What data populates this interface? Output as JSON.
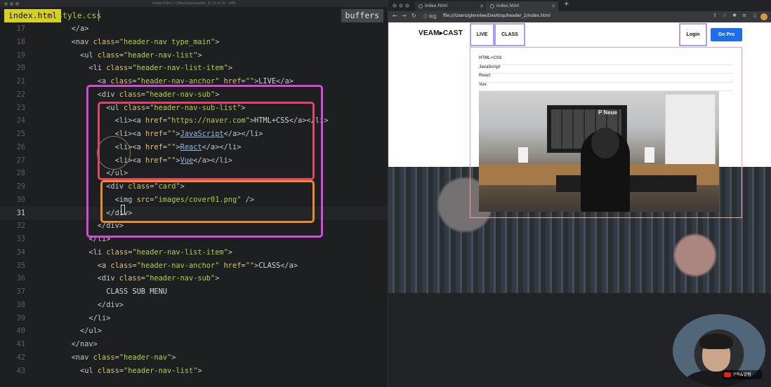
{
  "editor": {
    "window_title": "index.html (~/Desktop/header_2) (1 of 3) - VIM",
    "tabs": [
      {
        "label": "index.html",
        "active": true
      },
      {
        "label": "style.css",
        "active": false
      }
    ],
    "buffers_label": "buffers",
    "current_line": 31,
    "lines": [
      {
        "n": "17",
        "tokens": [
          [
            "i",
            "        "
          ],
          [
            "tag",
            "</a>"
          ]
        ]
      },
      {
        "n": "18",
        "tokens": [
          [
            "i",
            "        "
          ],
          [
            "tag",
            "<nav "
          ],
          [
            "attr",
            "class"
          ],
          [
            "tag",
            "="
          ],
          [
            "val",
            "\"header-nav type_main\""
          ],
          [
            "tag",
            ">"
          ]
        ]
      },
      {
        "n": "19",
        "tokens": [
          [
            "i",
            "          "
          ],
          [
            "tag",
            "<ul "
          ],
          [
            "attr",
            "class"
          ],
          [
            "tag",
            "="
          ],
          [
            "val",
            "\"header-nav-list\""
          ],
          [
            "tag",
            ">"
          ]
        ]
      },
      {
        "n": "20",
        "tokens": [
          [
            "i",
            "            "
          ],
          [
            "tag",
            "<li "
          ],
          [
            "attr",
            "class"
          ],
          [
            "tag",
            "="
          ],
          [
            "val",
            "\"header-nav-list-item\""
          ],
          [
            "tag",
            ">"
          ]
        ]
      },
      {
        "n": "21",
        "tokens": [
          [
            "i",
            "              "
          ],
          [
            "tag",
            "<a "
          ],
          [
            "attr",
            "class"
          ],
          [
            "tag",
            "="
          ],
          [
            "val",
            "\"header-nav-anchor\""
          ],
          [
            "tag",
            " "
          ],
          [
            "attr",
            "href"
          ],
          [
            "tag",
            "="
          ],
          [
            "val",
            "\"\""
          ],
          [
            "tag",
            ">"
          ],
          [
            "txt",
            "LIVE"
          ],
          [
            "tag",
            "</a>"
          ]
        ]
      },
      {
        "n": "22",
        "tokens": [
          [
            "i",
            "              "
          ],
          [
            "tag",
            "<div "
          ],
          [
            "attr",
            "class"
          ],
          [
            "tag",
            "="
          ],
          [
            "val",
            "\"header-nav-sub\""
          ],
          [
            "tag",
            ">"
          ]
        ]
      },
      {
        "n": "23",
        "tokens": [
          [
            "i",
            "                "
          ],
          [
            "tag",
            "<ul "
          ],
          [
            "attr",
            "class"
          ],
          [
            "tag",
            "="
          ],
          [
            "val",
            "\"header-nav-sub-list\""
          ],
          [
            "tag",
            ">"
          ]
        ]
      },
      {
        "n": "24",
        "tokens": [
          [
            "i",
            "                  "
          ],
          [
            "tag",
            "<li><a "
          ],
          [
            "attr",
            "href"
          ],
          [
            "tag",
            "="
          ],
          [
            "val",
            "\"https://naver.com\""
          ],
          [
            "tag",
            ">"
          ],
          [
            "txt",
            "HTML+CSS"
          ],
          [
            "tag",
            "</a></li>"
          ]
        ]
      },
      {
        "n": "25",
        "tokens": [
          [
            "i",
            "                  "
          ],
          [
            "tag",
            "<li><a "
          ],
          [
            "attr",
            "href"
          ],
          [
            "tag",
            "="
          ],
          [
            "val",
            "\"\""
          ],
          [
            "tag",
            ">"
          ],
          [
            "link",
            "JavaScript"
          ],
          [
            "tag",
            "</a></li>"
          ]
        ]
      },
      {
        "n": "26",
        "tokens": [
          [
            "i",
            "                  "
          ],
          [
            "tag",
            "<li><a "
          ],
          [
            "attr",
            "href"
          ],
          [
            "tag",
            "="
          ],
          [
            "val",
            "\"\""
          ],
          [
            "tag",
            ">"
          ],
          [
            "link",
            "React"
          ],
          [
            "tag",
            "</a></li>"
          ]
        ]
      },
      {
        "n": "27",
        "tokens": [
          [
            "i",
            "                  "
          ],
          [
            "tag",
            "<li><a "
          ],
          [
            "attr",
            "href"
          ],
          [
            "tag",
            "="
          ],
          [
            "val",
            "\"\""
          ],
          [
            "tag",
            ">"
          ],
          [
            "link",
            "Vue"
          ],
          [
            "tag",
            "</a></li>"
          ]
        ]
      },
      {
        "n": "28",
        "tokens": [
          [
            "i",
            "                "
          ],
          [
            "tag",
            "</ul>"
          ]
        ]
      },
      {
        "n": "29",
        "tokens": [
          [
            "i",
            "                "
          ],
          [
            "tag",
            "<div "
          ],
          [
            "attr",
            "class"
          ],
          [
            "tag",
            "="
          ],
          [
            "val",
            "\"card\""
          ],
          [
            "tag",
            ">"
          ]
        ]
      },
      {
        "n": "30",
        "tokens": [
          [
            "i",
            "                  "
          ],
          [
            "tag",
            "<img "
          ],
          [
            "attr",
            "src"
          ],
          [
            "tag",
            "="
          ],
          [
            "val",
            "\"images/cover01.png\""
          ],
          [
            "tag",
            " />"
          ]
        ]
      },
      {
        "n": "31",
        "tokens": [
          [
            "i",
            "                "
          ],
          [
            "tag",
            "</div>"
          ]
        ]
      },
      {
        "n": "32",
        "tokens": [
          [
            "i",
            "              "
          ],
          [
            "tag",
            "</div>"
          ]
        ]
      },
      {
        "n": "33",
        "tokens": [
          [
            "i",
            "            "
          ],
          [
            "tag",
            "</li>"
          ]
        ]
      },
      {
        "n": "34",
        "tokens": [
          [
            "i",
            "            "
          ],
          [
            "tag",
            "<li "
          ],
          [
            "attr",
            "class"
          ],
          [
            "tag",
            "="
          ],
          [
            "val",
            "\"header-nav-list-item\""
          ],
          [
            "tag",
            ">"
          ]
        ]
      },
      {
        "n": "35",
        "tokens": [
          [
            "i",
            "              "
          ],
          [
            "tag",
            "<a "
          ],
          [
            "attr",
            "class"
          ],
          [
            "tag",
            "="
          ],
          [
            "val",
            "\"header-nav-anchor\""
          ],
          [
            "tag",
            " "
          ],
          [
            "attr",
            "href"
          ],
          [
            "tag",
            "="
          ],
          [
            "val",
            "\"\""
          ],
          [
            "tag",
            ">"
          ],
          [
            "txt",
            "CLASS"
          ],
          [
            "tag",
            "</a>"
          ]
        ]
      },
      {
        "n": "36",
        "tokens": [
          [
            "i",
            "              "
          ],
          [
            "tag",
            "<div "
          ],
          [
            "attr",
            "class"
          ],
          [
            "tag",
            "="
          ],
          [
            "val",
            "\"header-nav-sub\""
          ],
          [
            "tag",
            ">"
          ]
        ]
      },
      {
        "n": "37",
        "tokens": [
          [
            "i",
            "                "
          ],
          [
            "txt",
            "CLASS SUB MENU"
          ]
        ]
      },
      {
        "n": "38",
        "tokens": [
          [
            "i",
            "              "
          ],
          [
            "tag",
            "</div>"
          ]
        ]
      },
      {
        "n": "39",
        "tokens": [
          [
            "i",
            "            "
          ],
          [
            "tag",
            "</li>"
          ]
        ]
      },
      {
        "n": "40",
        "tokens": [
          [
            "i",
            "          "
          ],
          [
            "tag",
            "</ul>"
          ]
        ]
      },
      {
        "n": "41",
        "tokens": [
          [
            "i",
            "        "
          ],
          [
            "tag",
            "</nav>"
          ]
        ]
      },
      {
        "n": "42",
        "tokens": [
          [
            "i",
            "        "
          ],
          [
            "tag",
            "<nav "
          ],
          [
            "attr",
            "class"
          ],
          [
            "tag",
            "="
          ],
          [
            "val",
            "\"header-nav\""
          ],
          [
            "tag",
            ">"
          ]
        ]
      },
      {
        "n": "43",
        "tokens": [
          [
            "i",
            "          "
          ],
          [
            "tag",
            "<ul "
          ],
          [
            "attr",
            "class"
          ],
          [
            "tag",
            "="
          ],
          [
            "val",
            "\"header-nav-list\""
          ],
          [
            "tag",
            ">"
          ]
        ]
      }
    ],
    "colors": {
      "highlight_sub": "#d34cd8",
      "highlight_list": "#e2456a",
      "highlight_card": "#ec8a2a",
      "active_tab": "#d6cf26"
    }
  },
  "browser": {
    "tabs": [
      {
        "label": "index.html"
      },
      {
        "label": "index.html"
      }
    ],
    "new_tab": "+",
    "address": {
      "info": "ⓘ 파일",
      "url": "file:///Users/glennlee/Desktop/header_2/index.html"
    },
    "page": {
      "logo": "VEAM▸CAST",
      "nav": {
        "live": "LIVE",
        "class": "CLASS"
      },
      "login": "Login",
      "go_pro": "Go Pro",
      "sub_items": [
        "HTML+CSS",
        "JavaScript",
        "React",
        "Vue"
      ],
      "card_caption": "P Neue"
    }
  },
  "webcam": {
    "badge": "구독&알람"
  }
}
